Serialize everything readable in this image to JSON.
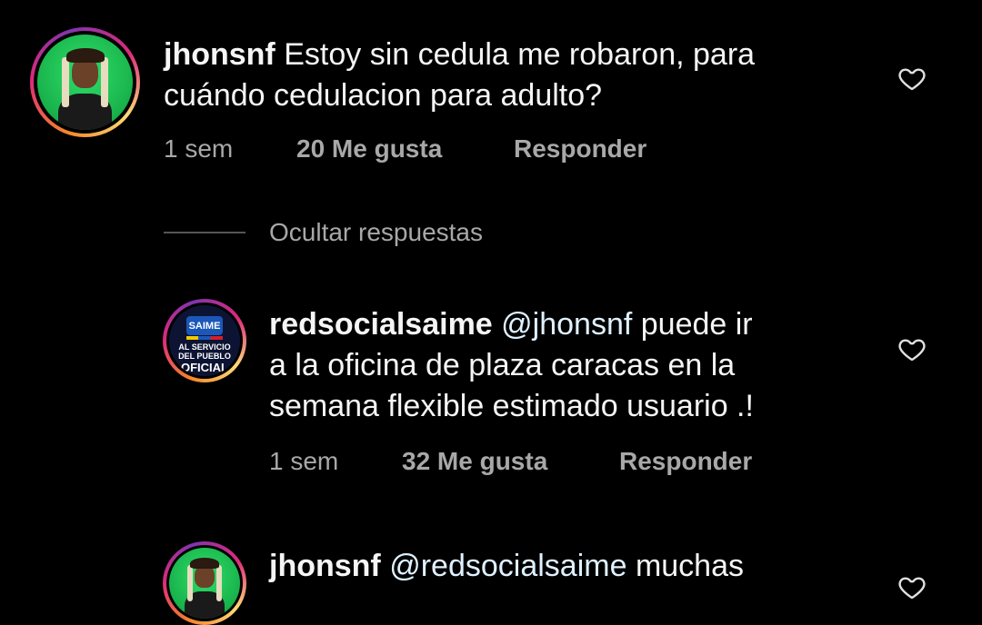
{
  "comments": [
    {
      "username": "jhonsnf",
      "text_line1": "Estoy sin cedula me robaron, para",
      "text_line2": "cuándo cedulacion  para adulto?",
      "time": "1 sem",
      "likes": "20 Me gusta",
      "reply": "Responder"
    },
    {
      "username": "redsocialsaime",
      "mention": "@jhonsnf",
      "text_line1": "puede ir",
      "text_line2": "a la oficina de plaza caracas en la",
      "text_line3": "semana flexible estimado usuario .!",
      "time": "1 sem",
      "likes": "32 Me gusta",
      "reply": "Responder",
      "avatar_label_top": "SAIME",
      "avatar_label_mid": "AL SERVICIO DEL PUEBLO",
      "avatar_label_bottom": "OFICIAL"
    },
    {
      "username": "jhonsnf",
      "mention": "@redsocialsaime",
      "text_line1": "muchas"
    }
  ],
  "hide_replies_label": "Ocultar respuestas",
  "icons": {
    "like": "heart-outline-icon"
  },
  "colors": {
    "background": "#000000",
    "text": "#f5f5f5",
    "secondary": "#a8a8a8"
  }
}
